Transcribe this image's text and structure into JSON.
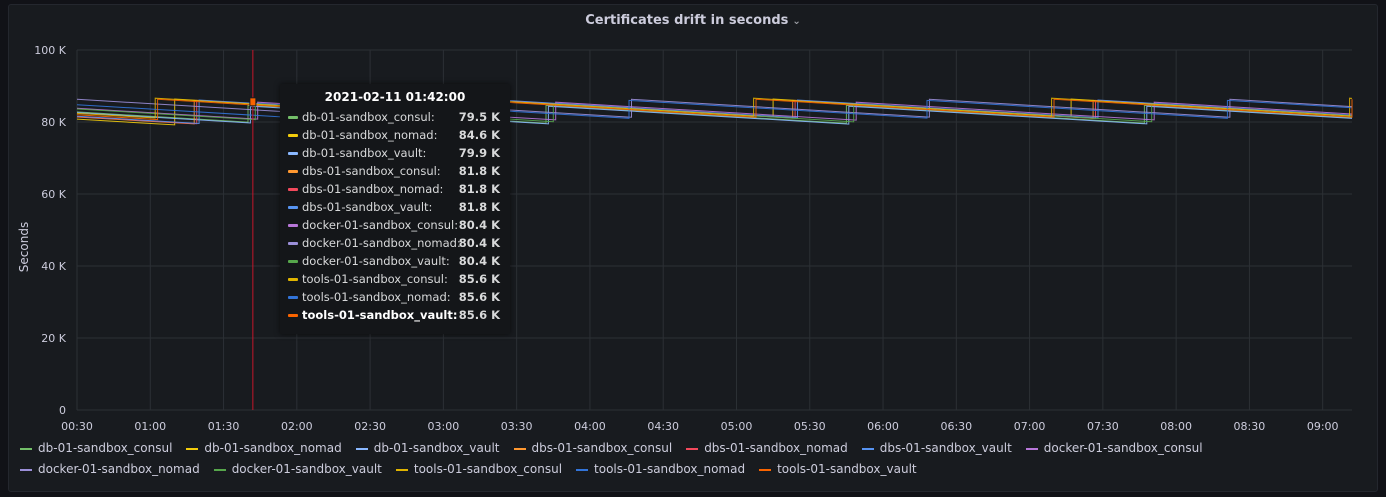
{
  "panel": {
    "title": "Certificates drift in seconds",
    "title_icon": "chevron-down-icon"
  },
  "chart_data": {
    "type": "line",
    "title": "Certificates drift in seconds",
    "xlabel": "",
    "ylabel": "Seconds",
    "ylim": [
      0,
      100000
    ],
    "yticks": [
      "0",
      "20 K",
      "40 K",
      "60 K",
      "80 K",
      "100 K"
    ],
    "xticks": [
      "00:30",
      "01:00",
      "01:30",
      "02:00",
      "02:30",
      "03:00",
      "03:30",
      "04:00",
      "04:30",
      "05:00",
      "05:30",
      "06:00",
      "06:30",
      "07:00",
      "07:30",
      "08:00",
      "08:30",
      "09:00"
    ],
    "x_minutes_range": [
      30,
      552
    ],
    "grid": true,
    "legend": "bottom",
    "hover_marker_minutes": 102,
    "series": [
      {
        "name": "db-01-sandbox_consul",
        "color": "#73bf69",
        "resets": [
          100,
          222,
          345,
          467
        ],
        "hi": 84600,
        "lo": 79300,
        "start": 82800
      },
      {
        "name": "db-01-sandbox_nomad",
        "color": "#f2cc0c",
        "resets": [
          70,
          193,
          315,
          437
        ],
        "hi": 86400,
        "lo": 79200,
        "start": 80800
      },
      {
        "name": "db-01-sandbox_vault",
        "color": "#8ab8ff",
        "resets": [
          101,
          223,
          346,
          468
        ],
        "hi": 84400,
        "lo": 79400,
        "start": 82600
      },
      {
        "name": "dbs-01-sandbox_consul",
        "color": "#ff9830",
        "resets": [
          78,
          201,
          323,
          446
        ],
        "hi": 86000,
        "lo": 79400,
        "start": 81400
      },
      {
        "name": "dbs-01-sandbox_nomad",
        "color": "#f2495c",
        "resets": [
          79,
          202,
          324,
          447
        ],
        "hi": 86000,
        "lo": 79400,
        "start": 81500
      },
      {
        "name": "dbs-01-sandbox_vault",
        "color": "#5794f2",
        "resets": [
          80,
          203,
          325,
          448
        ],
        "hi": 86100,
        "lo": 79500,
        "start": 81600
      },
      {
        "name": "docker-01-sandbox_consul",
        "color": "#b877d9",
        "resets": [
          104,
          226,
          349,
          471
        ],
        "hi": 85500,
        "lo": 79500,
        "start": 83800
      },
      {
        "name": "docker-01-sandbox_nomad",
        "color": "#9b8fd8",
        "resets": [
          134,
          257,
          379,
          502
        ],
        "hi": 86300,
        "lo": 79400,
        "start": 86300
      },
      {
        "name": "docker-01-sandbox_vault",
        "color": "#56a64b",
        "resets": [
          103,
          225,
          348,
          470
        ],
        "hi": 85000,
        "lo": 79300,
        "start": 83600
      },
      {
        "name": "tools-01-sandbox_consul",
        "color": "#e0b400",
        "resets": [
          62,
          184,
          307,
          429,
          551
        ],
        "hi": 86600,
        "lo": 79200,
        "start": 82400
      },
      {
        "name": "tools-01-sandbox_nomad",
        "color": "#3274d9",
        "resets": [
          133,
          256,
          378,
          501
        ],
        "hi": 86000,
        "lo": 79300,
        "start": 84800
      },
      {
        "name": "tools-01-sandbox_vault",
        "color": "#fa6400",
        "resets": [
          63,
          185,
          308,
          430,
          552
        ],
        "hi": 86300,
        "lo": 79300,
        "start": 82000
      }
    ]
  },
  "tooltip": {
    "time": "2021-02-11 01:42:00",
    "rows": [
      {
        "name": "db-01-sandbox_consul:",
        "value": "79.5 K",
        "color": "#73bf69"
      },
      {
        "name": "db-01-sandbox_nomad:",
        "value": "84.6 K",
        "color": "#f2cc0c"
      },
      {
        "name": "db-01-sandbox_vault:",
        "value": "79.9 K",
        "color": "#8ab8ff"
      },
      {
        "name": "dbs-01-sandbox_consul:",
        "value": "81.8 K",
        "color": "#ff9830"
      },
      {
        "name": "dbs-01-sandbox_nomad:",
        "value": "81.8 K",
        "color": "#f2495c"
      },
      {
        "name": "dbs-01-sandbox_vault:",
        "value": "81.8 K",
        "color": "#5794f2"
      },
      {
        "name": "docker-01-sandbox_consul:",
        "value": "80.4 K",
        "color": "#b877d9"
      },
      {
        "name": "docker-01-sandbox_nomad:",
        "value": "80.4 K",
        "color": "#9b8fd8"
      },
      {
        "name": "docker-01-sandbox_vault:",
        "value": "80.4 K",
        "color": "#56a64b"
      },
      {
        "name": "tools-01-sandbox_consul:",
        "value": "85.6 K",
        "color": "#e0b400"
      },
      {
        "name": "tools-01-sandbox_nomad:",
        "value": "85.6 K",
        "color": "#3274d9"
      },
      {
        "name": "tools-01-sandbox_vault:",
        "value": "85.6 K",
        "color": "#fa6400",
        "highlight": true
      }
    ]
  }
}
